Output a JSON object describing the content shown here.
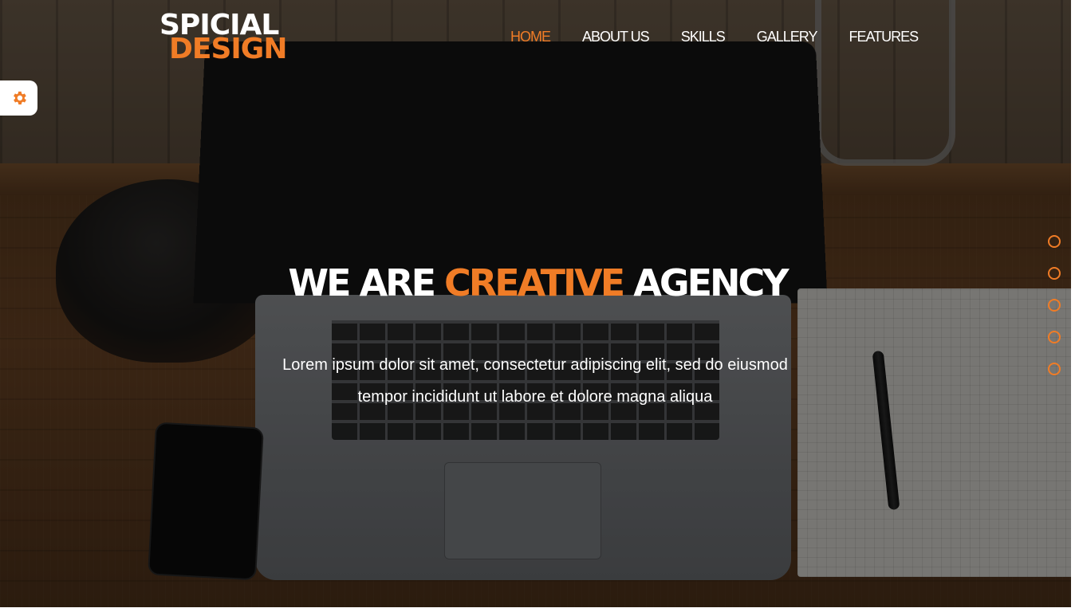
{
  "logo": {
    "line1": "SPICIAL",
    "line2": "DESIGN"
  },
  "nav": {
    "items": [
      {
        "label": "HOME",
        "active": true
      },
      {
        "label": "ABOUT US",
        "active": false
      },
      {
        "label": "SKILLS",
        "active": false
      },
      {
        "label": "GALLERY",
        "active": false
      },
      {
        "label": "FEATURES",
        "active": false
      }
    ]
  },
  "settings": {
    "icon": "gear-icon"
  },
  "hero": {
    "headline_part1": "WE ARE",
    "headline_accent": "CREATIVE",
    "headline_part3": "AGENCY",
    "subtext_line1": "Lorem ipsum dolor sit amet, consectetur adipiscing elit, sed do eiusmod",
    "subtext_line2": "tempor incididunt ut labore et dolore magna aliqua"
  },
  "bullets": {
    "count": 5
  },
  "colors": {
    "accent": "#f07c26",
    "text": "#ffffff"
  }
}
